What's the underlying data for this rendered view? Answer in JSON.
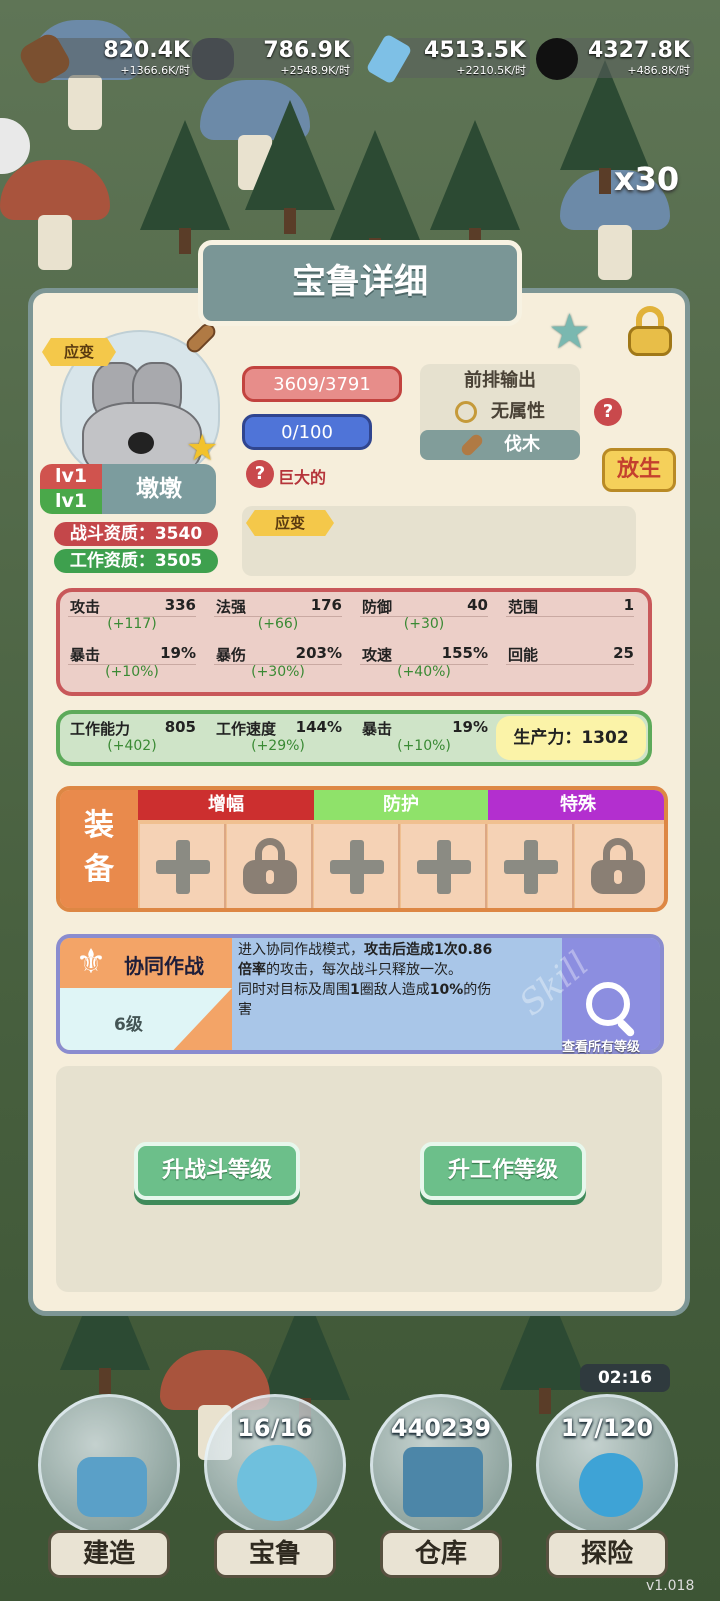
{
  "resources": [
    {
      "icon": "wood-log-icon",
      "amount": "820.4K",
      "rate": "+1366.6K/时",
      "color": "#6b4a2b"
    },
    {
      "icon": "stone-icon",
      "amount": "786.9K",
      "rate": "+2548.9K/时",
      "color": "#3b3f42"
    },
    {
      "icon": "crystal-icon",
      "amount": "4513.5K",
      "rate": "+2210.5K/时",
      "color": "#78b6dd"
    },
    {
      "icon": "coal-icon",
      "amount": "4327.8K",
      "rate": "+486.8K/时",
      "color": "#1c1c1c"
    }
  ],
  "side": {
    "multiplier": "x30"
  },
  "panel": {
    "title": "宝鲁详细",
    "trait_tag": "应变",
    "level_combat": "lv1",
    "level_work": "lv1",
    "name": "墩墩",
    "combat_aptitude": "战斗资质：3540",
    "work_aptitude": "工作资质：3505",
    "hp": "3609/3791",
    "mp": "0/100",
    "trait_desc": "巨大的",
    "role": "前排输出",
    "element": "无属性",
    "job": "伐木",
    "release_label": "放生",
    "skill_tag": "应变"
  },
  "combat_stats": [
    {
      "label": "攻击",
      "value": "336",
      "bonus": "(+117)"
    },
    {
      "label": "法强",
      "value": "176",
      "bonus": "(+66)"
    },
    {
      "label": "防御",
      "value": "40",
      "bonus": "(+30)"
    },
    {
      "label": "范围",
      "value": "1",
      "bonus": ""
    },
    {
      "label": "暴击",
      "value": "19%",
      "bonus": "(+10%)"
    },
    {
      "label": "暴伤",
      "value": "203%",
      "bonus": "(+30%)"
    },
    {
      "label": "攻速",
      "value": "155%",
      "bonus": "(+40%)"
    },
    {
      "label": "回能",
      "value": "25",
      "bonus": ""
    }
  ],
  "work_stats": [
    {
      "label": "工作能力",
      "value": "805",
      "bonus": "(+402)"
    },
    {
      "label": "工作速度",
      "value": "144%",
      "bonus": "(+29%)"
    },
    {
      "label": "暴击",
      "value": "19%",
      "bonus": "(+10%)"
    }
  ],
  "productivity": "生产力：1302",
  "equipment": {
    "label_line1": "装",
    "label_line2": "备",
    "categories": [
      {
        "label": "增幅",
        "color": "#cc2f2f"
      },
      {
        "label": "防护",
        "color": "#8fe26a"
      },
      {
        "label": "特殊",
        "color": "#b32fcf"
      }
    ]
  },
  "skill": {
    "name": "协同作战",
    "level": "6级",
    "desc_line1_pre": "进入协同作战模式，",
    "desc_line1_bold": "攻击后造成1次0.86",
    "desc_line2_bold": "倍率",
    "desc_line2_post": "的攻击，每次战斗只释放一次。",
    "desc_line3_pre": "同时对目标及周围",
    "desc_line3_bold1": "1",
    "desc_line3_mid": "圈敌人造成",
    "desc_line3_bold2": "10%",
    "desc_line3_post": "的伤",
    "desc_line4": "害",
    "watermark": "Skill",
    "see_all": "查看所有等级"
  },
  "buttons": {
    "upgrade_combat": "升战斗等级",
    "upgrade_work": "升工作等级"
  },
  "nav": [
    {
      "label": "建造",
      "count": ""
    },
    {
      "label": "宝鲁",
      "count": "16/16"
    },
    {
      "label": "仓库",
      "count": "440239"
    },
    {
      "label": "探险",
      "count": "17/120"
    }
  ],
  "timer": "02:16",
  "version": "v1.018"
}
